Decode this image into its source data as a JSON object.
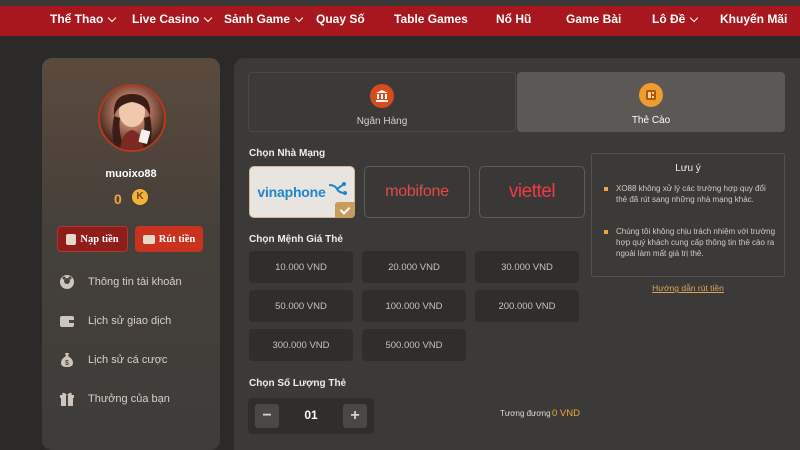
{
  "nav": {
    "items": [
      {
        "label": "Thể Thao",
        "dropdown": true
      },
      {
        "label": "Live Casino",
        "dropdown": true
      },
      {
        "label": "Sảnh Game",
        "dropdown": true
      },
      {
        "label": "Quay Số",
        "dropdown": false
      },
      {
        "label": "Table Games",
        "dropdown": false
      },
      {
        "label": "Nổ Hũ",
        "dropdown": false
      },
      {
        "label": "Game Bài",
        "dropdown": false
      },
      {
        "label": "Lô Đề",
        "dropdown": true
      },
      {
        "label": "Khuyến Mãi",
        "dropdown": false
      }
    ]
  },
  "profile": {
    "username": "muoixo88",
    "balance": "0",
    "coin_symbol": "K",
    "deposit_label": "Nạp tiền",
    "withdraw_label": "Rút tiền"
  },
  "sidebar": {
    "items": [
      {
        "label": "Thông tin tài khoản",
        "icon": "user-icon"
      },
      {
        "label": "Lịch sử giao dịch",
        "icon": "wallet-icon"
      },
      {
        "label": "Lịch sử cá cược",
        "icon": "money-bag-icon"
      },
      {
        "label": "Thưởng của bạn",
        "icon": "gift-icon"
      }
    ]
  },
  "tabs": {
    "bank": "Ngân Hàng",
    "card": "Thẻ Cào",
    "active": "card"
  },
  "carrier_section": {
    "title": "Chọn Nhà Mạng",
    "carriers": [
      "vinaphone",
      "mobifone",
      "viettel"
    ],
    "selected": "vinaphone"
  },
  "denomination_section": {
    "title": "Chọn Mệnh Giá Thẻ",
    "values": [
      "10.000 VND",
      "20.000 VND",
      "30.000 VND",
      "50.000 VND",
      "100.000 VND",
      "200.000 VND",
      "300.000 VND",
      "500.000 VND"
    ]
  },
  "quantity_section": {
    "title": "Chọn Số Lượng Thẻ",
    "value": "01",
    "minus": "−",
    "plus": "+",
    "equiv_label": "Tương đương",
    "equiv_value": "0 VND"
  },
  "note": {
    "title": "Lưu ý",
    "items": [
      "XO88 không xử lý các trường hợp quy đổi thẻ đã rút sang những nhà mạng khác.",
      "Chúng tôi không chịu trách nhiệm với trường hợp quý khách cung cấp thông tin thẻ cào ra ngoài làm mất giá trị thẻ."
    ],
    "guide_link": "Hướng dẫn rút tiền"
  },
  "colors": {
    "nav_bg": "#a8171d",
    "accent_gold": "#f0a63a",
    "panel_bg": "#3c3a38",
    "page_bg": "#2b2a29"
  }
}
